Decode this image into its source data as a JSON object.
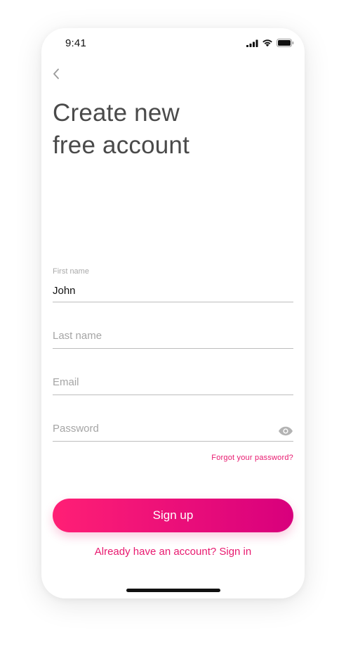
{
  "status_bar": {
    "time": "9:41",
    "icons": [
      "signal-icon",
      "wifi-icon",
      "battery-icon"
    ]
  },
  "navigation": {
    "back_icon": "chevron-left-icon"
  },
  "title": {
    "line1": "Create new",
    "line2": "free account"
  },
  "form": {
    "first_name": {
      "label": "First name",
      "value": "John"
    },
    "last_name": {
      "placeholder": "Last name"
    },
    "email": {
      "placeholder": "Email"
    },
    "password": {
      "placeholder": "Password",
      "toggle_icon": "eye-icon"
    },
    "forgot_password": "Forgot your password?"
  },
  "actions": {
    "signup_label": "Sign up",
    "signin_prompt": "Already have an account? Sign in"
  },
  "colors": {
    "accent": "#e8196f",
    "button_gradient_start": "#ff1f75",
    "button_gradient_end": "#d8007d",
    "title_text": "#4a4a4a",
    "divider": "#bdbdbd"
  }
}
